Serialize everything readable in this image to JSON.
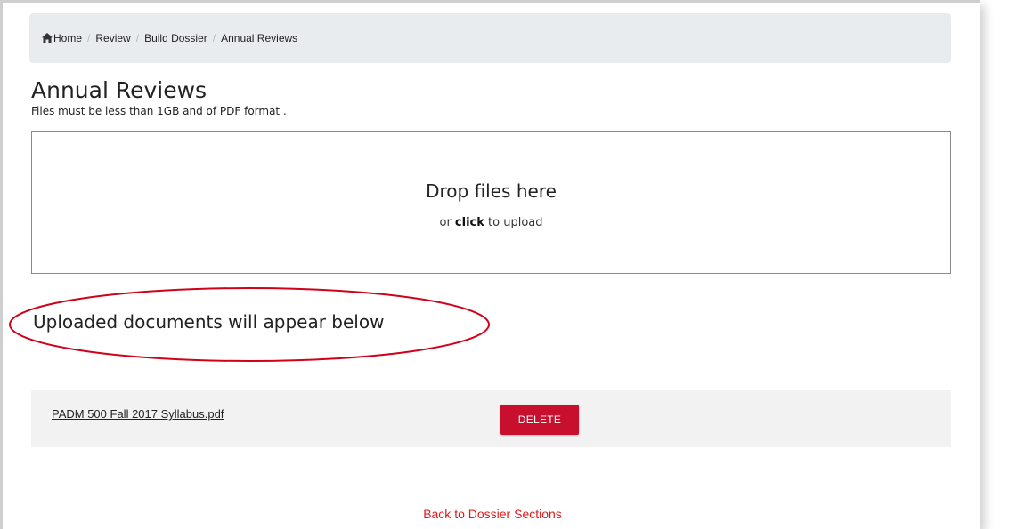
{
  "breadcrumb": {
    "items": [
      "Home",
      "Review",
      "Build Dossier",
      "Annual Reviews"
    ],
    "separator": "/"
  },
  "page": {
    "title": "Annual Reviews",
    "hint": "Files must be less than 1GB and of PDF format ."
  },
  "dropzone": {
    "title": "Drop files here",
    "sub_prefix": "or ",
    "sub_bold": "click",
    "sub_suffix": " to upload"
  },
  "uploaded": {
    "heading": "Uploaded documents will appear below",
    "files": [
      {
        "name": "PADM 500 Fall 2017 Syllabus.pdf",
        "delete_label": "DELETE"
      }
    ]
  },
  "footer": {
    "back_label": "Back to Dossier Sections"
  },
  "colors": {
    "accent": "#c8102e",
    "link_red": "#e01a1a",
    "annotation": "#d0021b",
    "breadcrumb_bg": "#e9ecef"
  },
  "icons": {
    "home": "home-icon"
  }
}
